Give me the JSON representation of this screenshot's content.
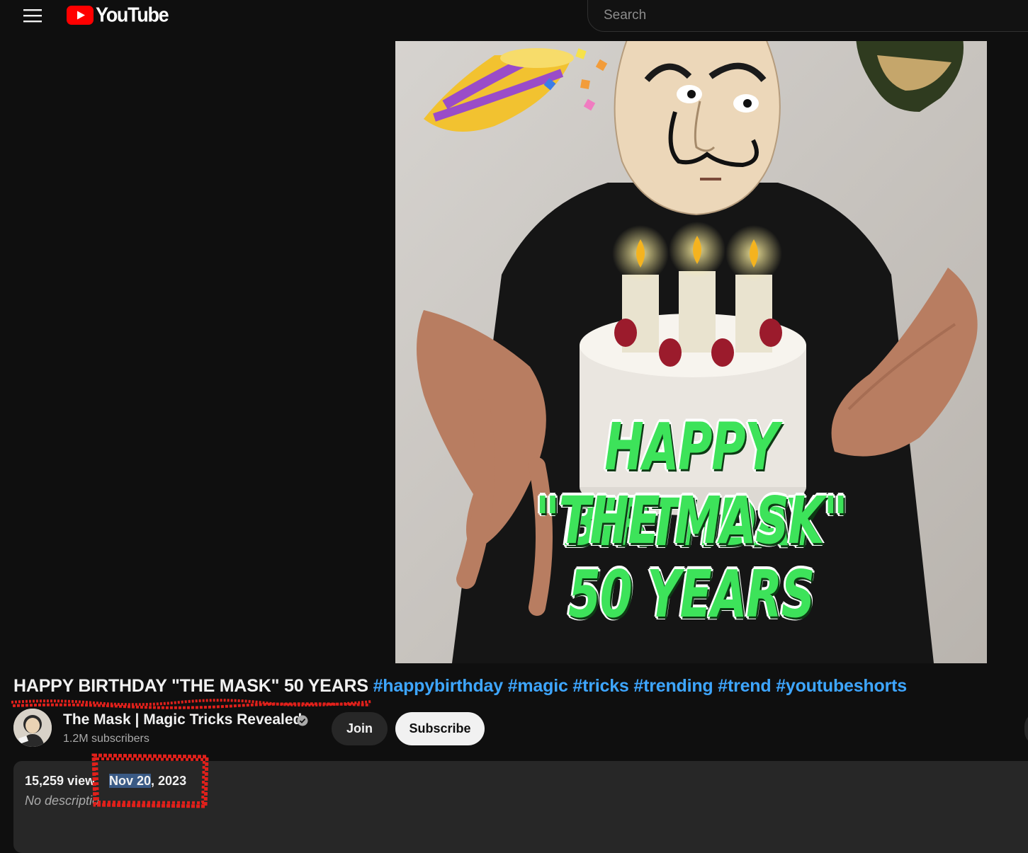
{
  "header": {
    "logo_text": "YouTube",
    "search_placeholder": "Search"
  },
  "video": {
    "overlay_line1": "HAPPY BIRTHDAY",
    "overlay_line2": "\"THE MASK\"",
    "overlay_line3": "50 YEARS"
  },
  "title": {
    "main": "HAPPY BIRTHDAY \"THE MASK\" 50 YEARS",
    "hashtags": [
      "#happybirthday",
      "#magic",
      "#tricks",
      "#trending",
      "#trend",
      "#youtubeshorts"
    ]
  },
  "channel": {
    "name": "The Mask | Magic Tricks Revealed",
    "subscribers": "1.2M subscribers",
    "join_label": "Join",
    "subscribe_label": "Subscribe"
  },
  "description": {
    "views": "15,259 view",
    "date_highlight": "Nov 20",
    "date_rest": ", 2023",
    "text": "No descriptio"
  },
  "colors": {
    "background": "#0f0f0f",
    "hashtag": "#3ea6ff",
    "annotation_red": "#e0201b",
    "logo_red": "#ff0000",
    "overlay_green": "#3de35a"
  },
  "icons": [
    "menu-icon",
    "youtube-play-icon",
    "verified-check-icon"
  ]
}
